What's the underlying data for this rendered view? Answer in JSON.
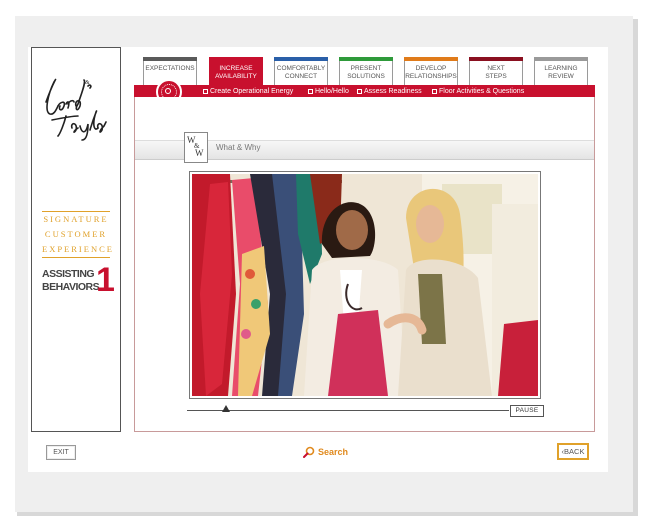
{
  "brand": {
    "logo_text": "Lord & Taylor",
    "program_lines": [
      "SIGNATURE",
      "CUSTOMER",
      "EXPERIENCE"
    ],
    "module_lines": [
      "ASSISTING",
      "BEHAVIORS"
    ],
    "module_number": "1"
  },
  "tabs": [
    {
      "line1": "EXPECTATIONS",
      "line2": "",
      "color": "#5a5a5a",
      "active": false
    },
    {
      "line1": "INCREASE",
      "line2": "AVAILABILITY",
      "color": "#c8102e",
      "active": true
    },
    {
      "line1": "COMFORTABLY",
      "line2": "CONNECT",
      "color": "#2a5fa8",
      "active": false
    },
    {
      "line1": "PRESENT",
      "line2": "SOLUTIONS",
      "color": "#2e9a3a",
      "active": false
    },
    {
      "line1": "DEVELOP",
      "line2": "RELATIONSHIPS",
      "color": "#e07b1a",
      "active": false
    },
    {
      "line1": "NEXT",
      "line2": "STEPS",
      "color": "#8a1020",
      "active": false
    },
    {
      "line1": "LEARNING",
      "line2": "REVIEW",
      "color": "#9a9a9a",
      "active": false
    }
  ],
  "subnav": [
    "Create Operational Energy",
    "Hello/Hello",
    "Assess Readiness",
    "Floor Activities & Questions"
  ],
  "section": {
    "badge_letters": [
      "W",
      "&",
      "W"
    ],
    "title": "What & Why"
  },
  "video": {
    "scene": "two-women-shopping-clothing-rack",
    "progress": 0.12
  },
  "controls": {
    "pause_label": "PAUSE",
    "exit_label": "EXIT",
    "search_label": "Search",
    "back_label": "BACK"
  },
  "colors": {
    "brand_red": "#c8102e",
    "gold": "#e0a12a",
    "search_orange": "#e08a1e"
  }
}
